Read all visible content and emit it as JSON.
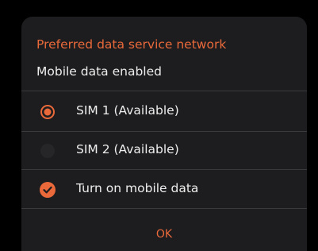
{
  "dialog": {
    "title": "Preferred data service network",
    "subtitle": "Mobile data enabled",
    "options": [
      {
        "label": "SIM 1 (Available)",
        "selected": true
      },
      {
        "label": "SIM 2 (Available)",
        "selected": false
      }
    ],
    "toggle": {
      "label": "Turn on mobile data",
      "checked": true
    },
    "ok_label": "OK"
  },
  "colors": {
    "accent": "#e9693a",
    "dialog_background": "#1d1d1f",
    "text": "#ededed",
    "divider": "#3a3a3c"
  }
}
